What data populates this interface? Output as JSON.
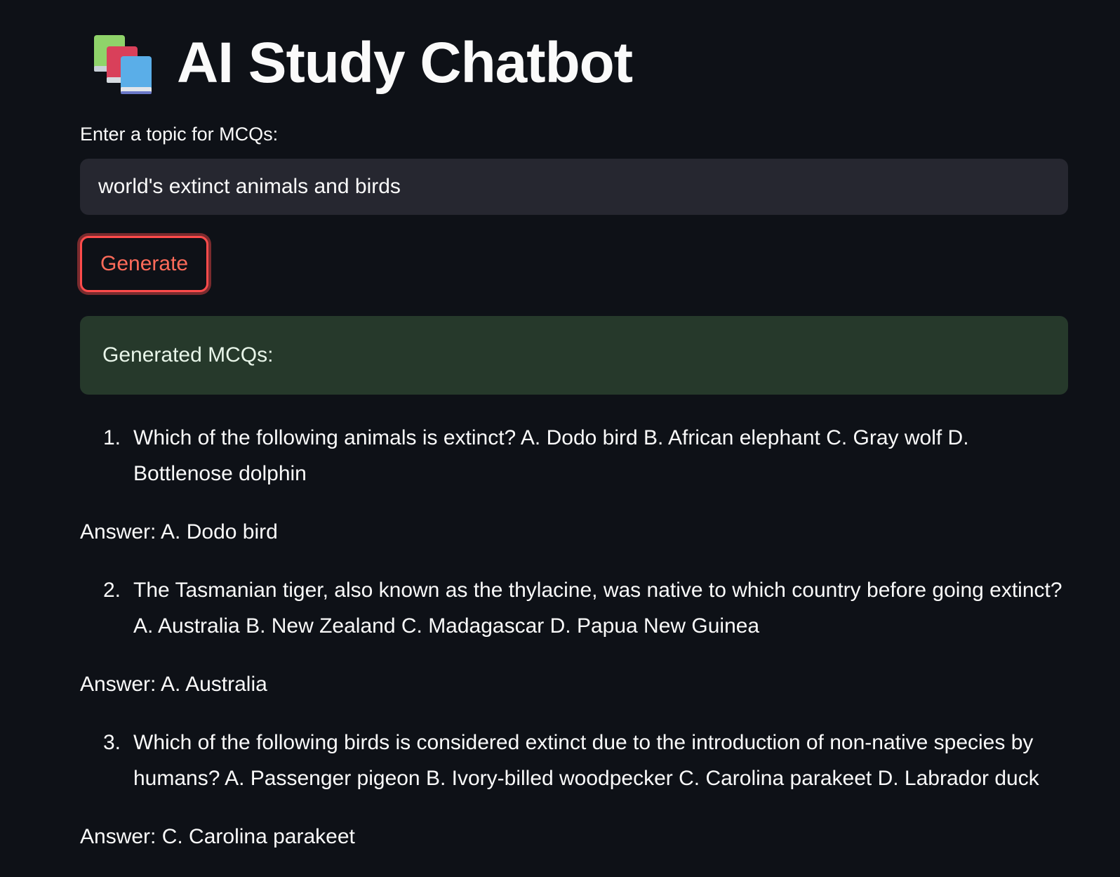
{
  "header": {
    "icon": "books-icon",
    "title": "AI Study Chatbot"
  },
  "form": {
    "label": "Enter a topic for MCQs:",
    "input_value": "world's extinct animals and birds",
    "button_label": "Generate"
  },
  "result": {
    "banner": "Generated MCQs:",
    "questions": [
      {
        "number": "1.",
        "text": "Which of the following animals is extinct? A. Dodo bird B. African elephant C. Gray wolf D. Bottlenose dolphin",
        "answer": "Answer: A. Dodo bird"
      },
      {
        "number": "2.",
        "text": "The Tasmanian tiger, also known as the thylacine, was native to which country before going extinct? A. Australia B. New Zealand C. Madagascar D. Papua New Guinea",
        "answer": "Answer: A. Australia"
      },
      {
        "number": "3.",
        "text": "Which of the following birds is considered extinct due to the introduction of non-native species by humans? A. Passenger pigeon B. Ivory-billed woodpecker C. Carolina parakeet D. Labrador duck",
        "answer": "Answer: C. Carolina parakeet"
      }
    ]
  },
  "colors": {
    "background": "#0e1117",
    "input_background": "#262730",
    "accent": "#ff4b4b",
    "success_background": "#26392b",
    "text": "#fafafa"
  }
}
